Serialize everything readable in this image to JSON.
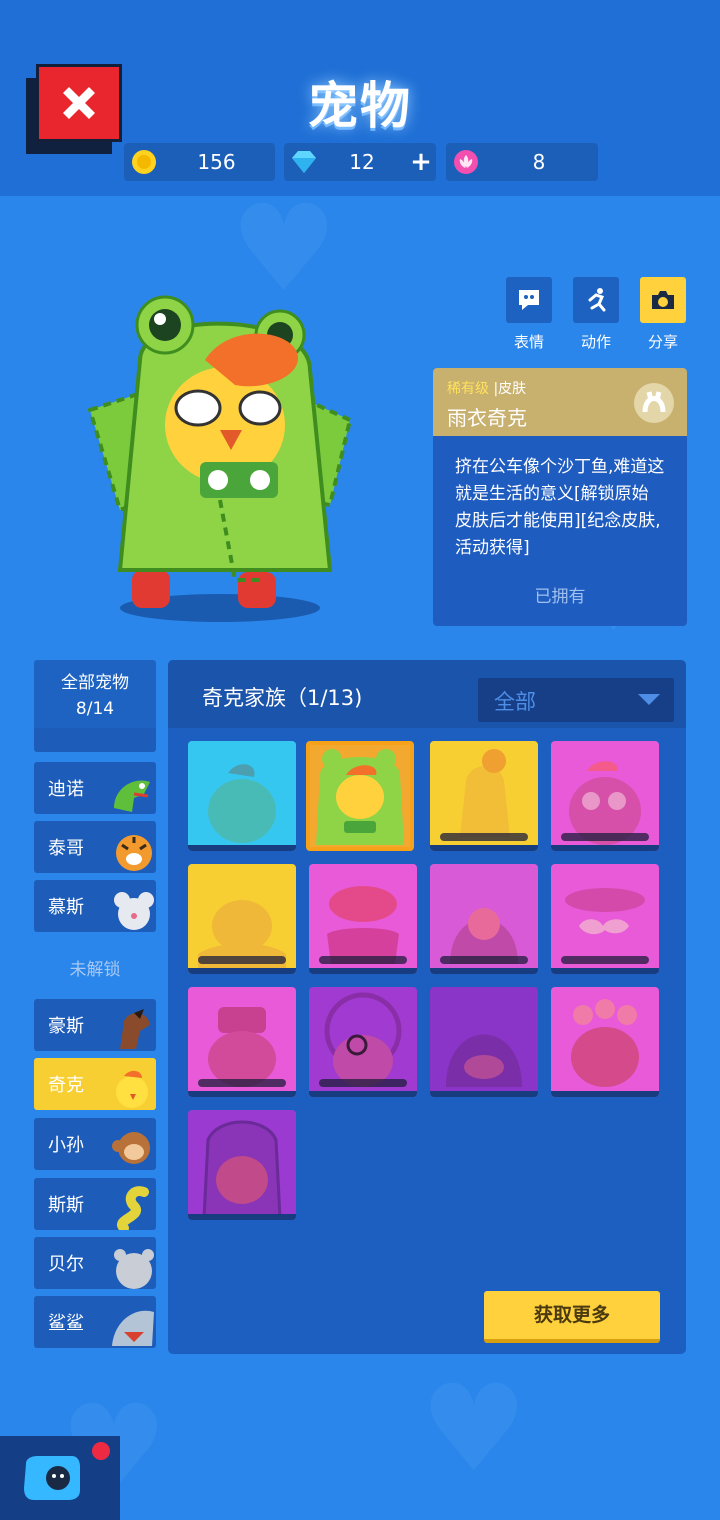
{
  "title": "宠物",
  "currencies": [
    {
      "icon": "coin-icon",
      "value": "156"
    },
    {
      "icon": "diamond-icon",
      "value": "12",
      "plus": "+"
    },
    {
      "icon": "flower-token-icon",
      "value": "8"
    }
  ],
  "actions": [
    {
      "icon": "emote-icon",
      "label": "表情"
    },
    {
      "icon": "running-figure-icon",
      "label": "动作"
    },
    {
      "icon": "camera-icon",
      "label": "分享"
    }
  ],
  "skin": {
    "rarity": "稀有级",
    "separator": "|",
    "type": "皮肤",
    "name": "雨衣奇克",
    "description": "挤在公车像个沙丁鱼,难道这就是生活的意义[解锁原始皮肤后才能使用][纪念皮肤,活动获得]",
    "status": "已拥有"
  },
  "sidebar": {
    "header_line1": "全部宠物",
    "header_line2": "8/14",
    "unlocked": [
      "迪诺",
      "泰哥",
      "慕斯"
    ],
    "locked_label": "未解锁",
    "locked": [
      "豪斯",
      "奇克",
      "小孙",
      "斯斯",
      "贝尔",
      "鲨鲨"
    ],
    "active": "奇克"
  },
  "panel": {
    "family": "奇克家族（1/13)",
    "filter": "全部",
    "get_more": "获取更多"
  },
  "colors": {
    "background": "#2a86ea",
    "accent_yellow": "#ffd23d",
    "selected_border": "#f7a11b",
    "close_red": "#e9262e"
  }
}
